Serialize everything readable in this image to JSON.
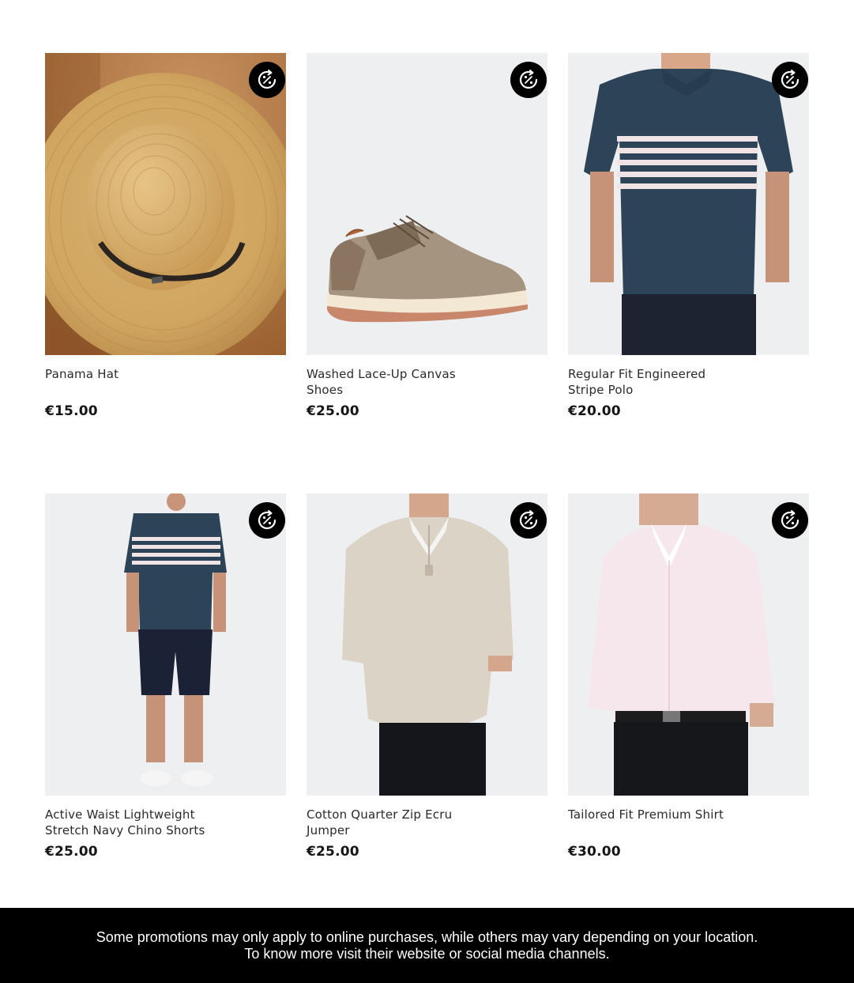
{
  "products": [
    {
      "name": "Panama Hat",
      "price": "€15.00",
      "badge_icon": "discount-refresh-icon"
    },
    {
      "name": "Washed Lace-Up Canvas Shoes",
      "price": "€25.00",
      "badge_icon": "discount-refresh-icon"
    },
    {
      "name": "Regular Fit Engineered Stripe Polo",
      "price": "€20.00",
      "badge_icon": "discount-refresh-icon"
    },
    {
      "name": "Active Waist Lightweight Stretch Navy Chino Shorts",
      "price": "€25.00",
      "badge_icon": "discount-refresh-icon"
    },
    {
      "name": "Cotton Quarter Zip Ecru Jumper",
      "price": "€25.00",
      "badge_icon": "discount-refresh-icon"
    },
    {
      "name": "Tailored Fit Premium Shirt",
      "price": "€30.00",
      "badge_icon": "discount-refresh-icon"
    }
  ],
  "footer": {
    "line1": "Some promotions may only apply to online purchases, while others may vary depending on your location.",
    "line2": "To know more visit their website or social media channels."
  },
  "colors": {
    "badge": "#000000",
    "footer_bg": "#000000",
    "footer_text": "#ffffff",
    "image_bg": "#eeeff1"
  }
}
